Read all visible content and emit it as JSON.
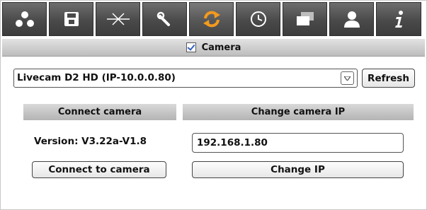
{
  "toolbar": {
    "tabs": [
      {
        "icon": "network-nodes-icon",
        "active": false
      },
      {
        "icon": "save-disk-icon",
        "active": false
      },
      {
        "icon": "antenna-signal-icon",
        "active": false
      },
      {
        "icon": "wrench-icon",
        "active": false
      },
      {
        "icon": "sync-arrows-icon",
        "active": true
      },
      {
        "icon": "clock-icon",
        "active": false
      },
      {
        "icon": "windows-icon",
        "active": false
      },
      {
        "icon": "user-icon",
        "active": false
      },
      {
        "icon": "info-icon",
        "active": false
      }
    ],
    "colors": {
      "tab_bg": "#4a4a4a",
      "icon": "#ffffff",
      "active_icon": "#f39a1e"
    }
  },
  "camera_header": {
    "checked": true,
    "label": "Camera"
  },
  "camera_select": {
    "value": "Livecam D2 HD (IP-10.0.0.80)",
    "refresh_label": "Refresh"
  },
  "connect_section": {
    "title": "Connect camera",
    "version_text": "Version: V3.22a-V1.8",
    "connect_button": "Connect to camera"
  },
  "ip_section": {
    "title": "Change camera IP",
    "ip_value": "192.168.1.80",
    "change_button": "Change IP"
  }
}
